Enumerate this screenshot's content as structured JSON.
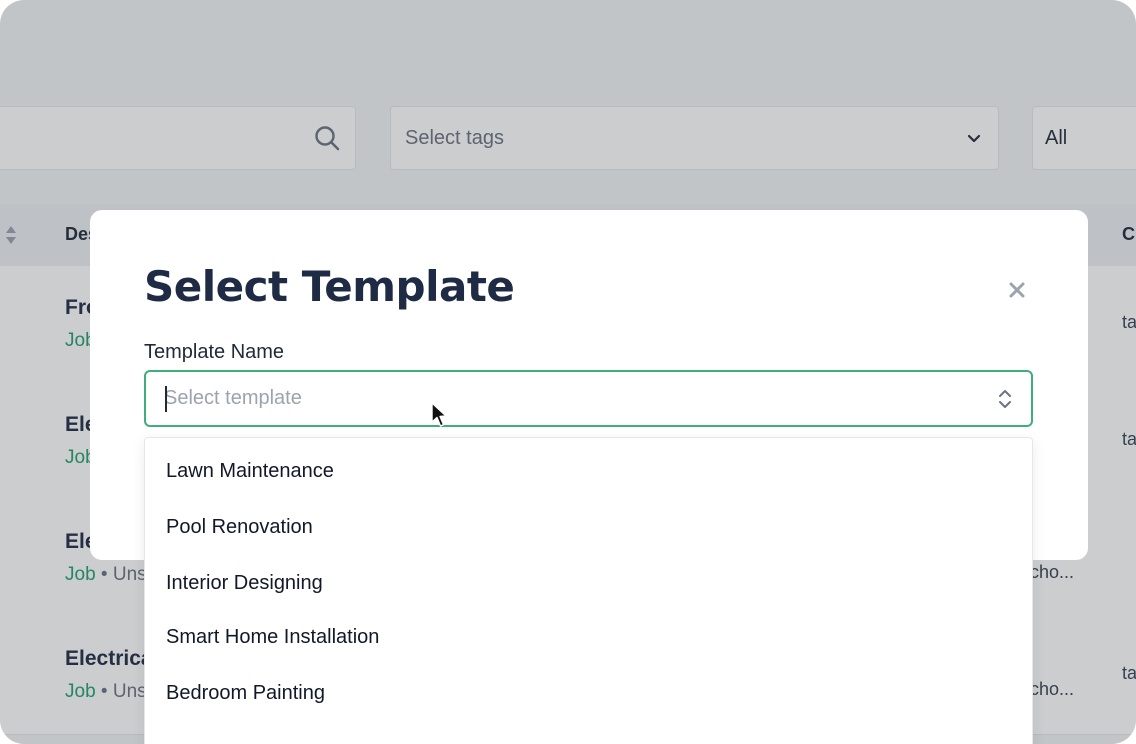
{
  "filters": {
    "tags_placeholder": "Select tags",
    "status_value": "All"
  },
  "table": {
    "headers": [
      "Des",
      "Cu"
    ],
    "rows": [
      {
        "title": "Fro",
        "type": "Job",
        "rest": "",
        "col1": "",
        "col2": "ta"
      },
      {
        "title": "Ele",
        "type": "Job",
        "rest": "",
        "col1": "",
        "col2": "ta"
      },
      {
        "title": "Ele",
        "type": "Job",
        "rest": " • Uns",
        "col1": "cho...",
        "col2": ""
      },
      {
        "title": "Electrica",
        "type": "Job",
        "rest": " • Uns",
        "col1": "cho...",
        "col2": "ta"
      }
    ]
  },
  "modal": {
    "title": "Select Template",
    "field_label": "Template Name",
    "placeholder": "Select template",
    "options": [
      "Lawn Maintenance",
      "Pool Renovation",
      "Interior Designing",
      "Smart Home Installation",
      "Bedroom Painting"
    ]
  },
  "colors": {
    "accent_green": "#3fae7c",
    "job_green": "#22a06b",
    "title_navy": "#1f2a44"
  }
}
